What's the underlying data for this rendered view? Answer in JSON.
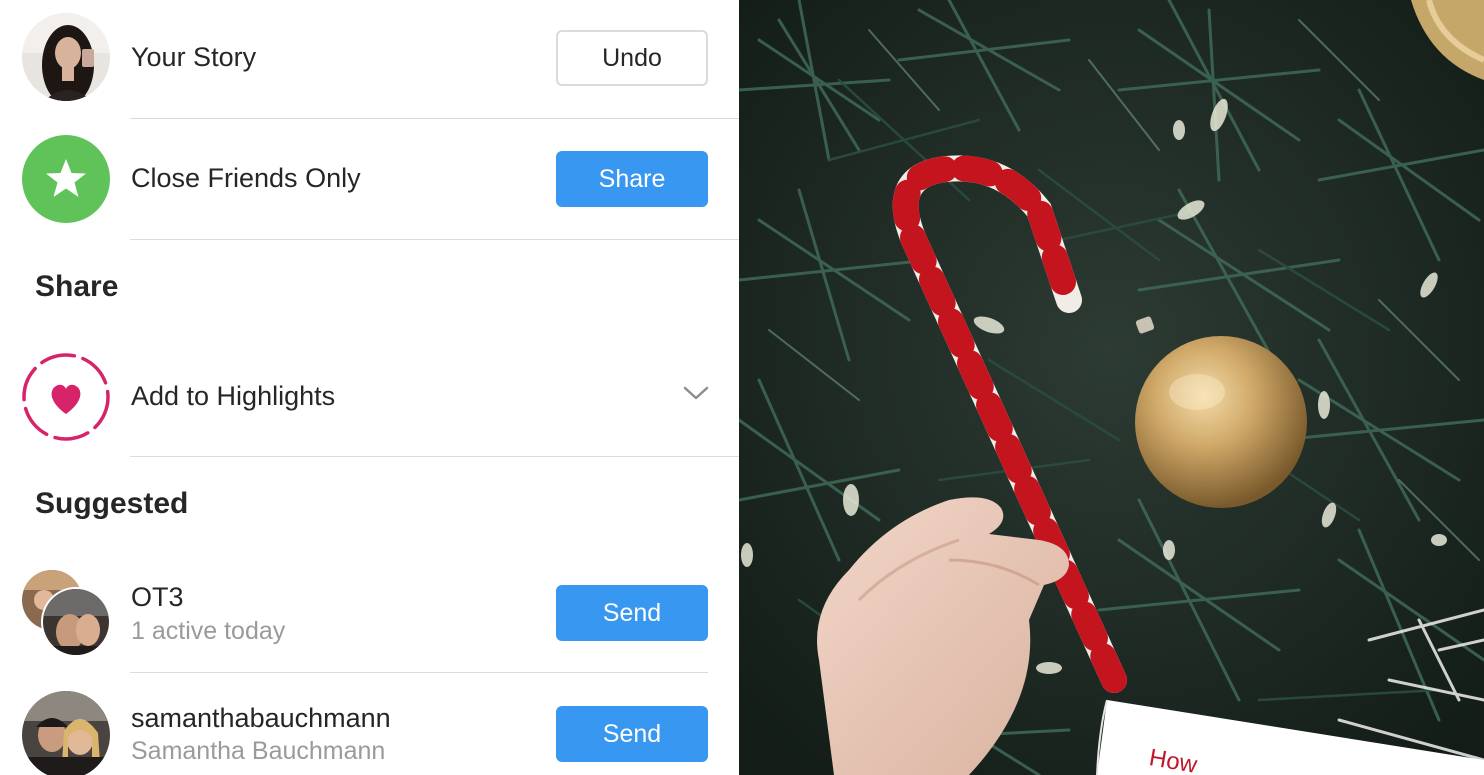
{
  "story": {
    "label": "Your Story",
    "button": "Undo"
  },
  "close_friends": {
    "label": "Close Friends Only",
    "button": "Share"
  },
  "share_section": {
    "title": "Share",
    "highlights_label": "Add to Highlights"
  },
  "suggested_section": {
    "title": "Suggested",
    "items": [
      {
        "name": "OT3",
        "subtitle": "1 active today",
        "button": "Send"
      },
      {
        "name": "samanthabauchmann",
        "subtitle": "Samantha Bauchmann",
        "button": "Send"
      }
    ]
  },
  "photo": {
    "card_text": "How"
  },
  "colors": {
    "accent_blue": "#3897f0",
    "close_friends_green": "#5fc35a",
    "highlight_pink": "#d6236a",
    "divider": "#dbdbdb"
  }
}
